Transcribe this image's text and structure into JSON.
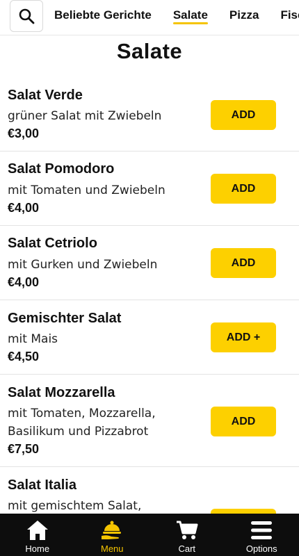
{
  "colors": {
    "accent": "#fdd000",
    "active_tab_underline": "#f5c400",
    "bottom_nav_bg": "#0d0d0d",
    "active_nav_label": "#f5c400"
  },
  "header": {
    "search_icon": "search-icon",
    "tabs": [
      {
        "label": "Beliebte Gerichte",
        "active": false
      },
      {
        "label": "Salate",
        "active": true
      },
      {
        "label": "Pizza",
        "active": false
      },
      {
        "label": "Fisch",
        "active": false
      }
    ]
  },
  "section": {
    "title": "Salate"
  },
  "items": [
    {
      "name": "Salat Verde",
      "description": "grüner Salat mit Zwiebeln",
      "price": "€3,00",
      "button": "ADD"
    },
    {
      "name": "Salat Pomodoro",
      "description": "mit Tomaten und Zwiebeln",
      "price": "€4,00",
      "button": "ADD"
    },
    {
      "name": "Salat Cetriolo",
      "description": "mit Gurken und Zwiebeln",
      "price": "€4,00",
      "button": "ADD"
    },
    {
      "name": "Gemischter Salat",
      "description": "mit Mais",
      "price": "€4,50",
      "button": "ADD +"
    },
    {
      "name": "Salat Mozzarella",
      "description": "mit Tomaten, Mozzarella, Basilikum und Pizzabrot",
      "price": "€7,50",
      "button": "ADD"
    },
    {
      "name": "Salat Italia",
      "description": "mit gemischtem Salat,",
      "price": "",
      "button": ""
    }
  ],
  "bottom_nav": [
    {
      "label": "Home",
      "icon": "home-icon",
      "active": false
    },
    {
      "label": "Menu",
      "icon": "menu-cloche-icon",
      "active": true
    },
    {
      "label": "Cart",
      "icon": "cart-icon",
      "active": false
    },
    {
      "label": "Options",
      "icon": "hamburger-icon",
      "active": false
    }
  ]
}
